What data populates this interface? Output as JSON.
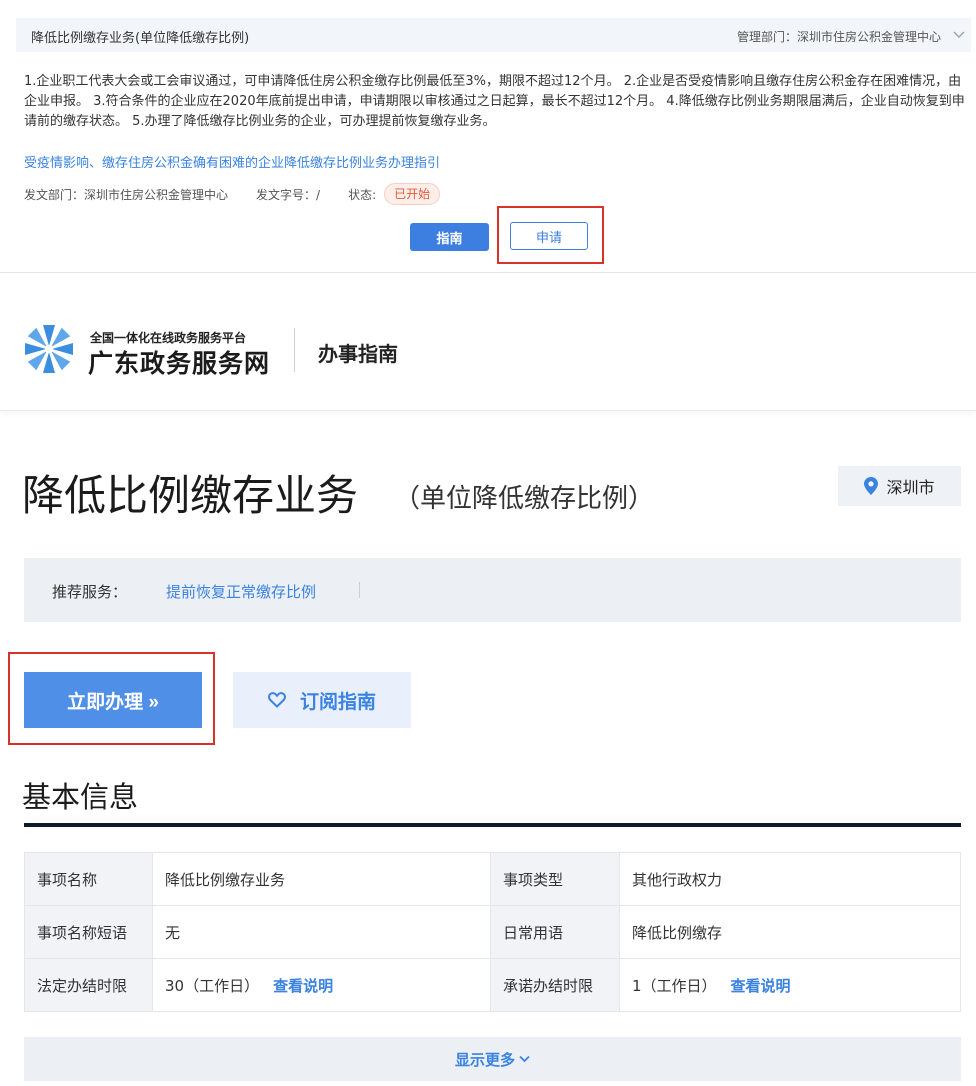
{
  "card": {
    "title": "降低比例缴存业务(单位降低缴存比例)",
    "dept_label": "管理部门：深圳市住房公积金管理中心",
    "description": "1.企业职工代表大会或工会审议通过，可申请降低住房公积金缴存比例最低至3%，期限不超过12个月。 2.企业是否受疫情影响且缴存住房公积金存在困难情况，由企业申报。 3.符合条件的企业应在2020年底前提出申请，申请期限以审核通过之日起算，最长不超过12个月。 4.降低缴存比例业务期限届满后，企业自动恢复到申请前的缴存状态。 5.办理了降低缴存比例业务的企业，可办理提前恢复缴存业务。",
    "guide_link": "受疫情影响、缴存住房公积金确有困难的企业降低缴存比例业务办理指引",
    "issuer": "发文部门：深圳市住房公积金管理中心",
    "doc_no": "发文字号：/",
    "status_label": "状态:",
    "status_value": "已开始",
    "guide_button": "指南",
    "apply_button": "申请"
  },
  "header": {
    "platform_sub": "全国一体化在线政务服务平台",
    "platform_name": "广东政务服务网",
    "section": "办事指南"
  },
  "page": {
    "title": "降低比例缴存业务",
    "subtitle": "（单位降低缴存比例）",
    "location": "深圳市"
  },
  "recommend": {
    "label": "推荐服务：",
    "link": "提前恢复正常缴存比例"
  },
  "actions": {
    "handle_now": "立即办理 »",
    "subscribe": "订阅指南"
  },
  "basic_info": {
    "title": "基本信息",
    "rows": [
      {
        "k1": "事项名称",
        "v1": "降低比例缴存业务",
        "k2": "事项类型",
        "v2": "其他行政权力"
      },
      {
        "k1": "事项名称短语",
        "v1": "无",
        "k2": "日常用语",
        "v2": "降低比例缴存"
      },
      {
        "k1": "法定办结时限",
        "v1": "30（工作日）",
        "link1": "查看说明",
        "k2": "承诺办结时限",
        "v2": "1（工作日）",
        "link2": "查看说明"
      }
    ],
    "show_more": "显示更多"
  },
  "colors": {
    "primary": "#3d7fe0",
    "highlight": "#d9322b",
    "status": "#e05a3b"
  }
}
